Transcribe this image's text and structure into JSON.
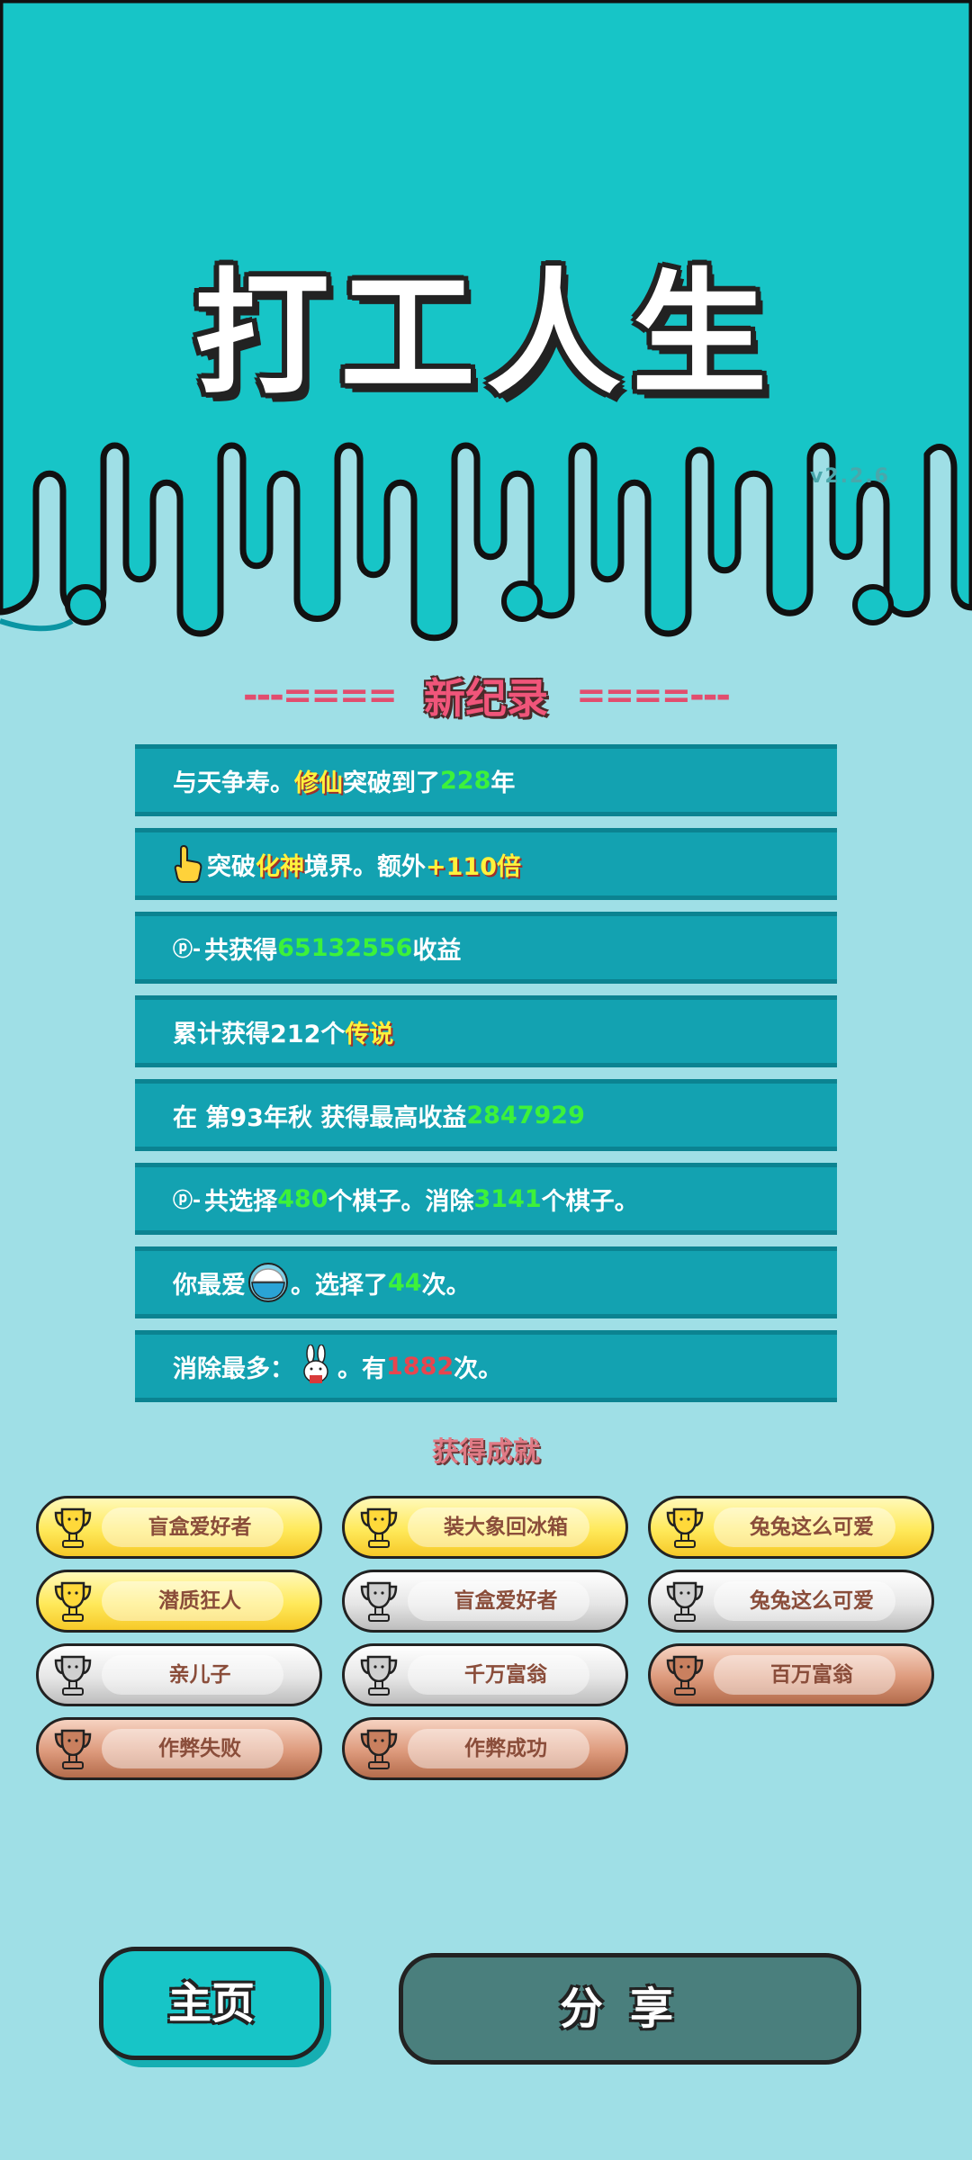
{
  "header": {
    "title": "打工人生",
    "version": "v2.2.6"
  },
  "records": {
    "title": "新纪录",
    "left_dashes": "---====",
    "right_dashes": "====---",
    "rows": [
      {
        "t1": "与天争寿。",
        "hl": "修仙",
        "t2": "突破到了",
        "num": "228",
        "t3": "年"
      },
      {
        "t1": "突破",
        "hl": "化神",
        "t2": "境界。额外",
        "num": "+110倍"
      },
      {
        "t1": "共获得",
        "num": "65132556",
        "t2": "收益"
      },
      {
        "t1": "累计获得212个",
        "hl": "传说"
      },
      {
        "t1": "在 第93年秋 获得最高收益",
        "num": "2847929"
      },
      {
        "t1": "共选择",
        "num": "480",
        "t2": "个棋子。消除",
        "num2": "3141",
        "t3": "个棋子。"
      },
      {
        "t1": "你最爱",
        "t2": "。选择了",
        "num": "44",
        "t3": "次。"
      },
      {
        "t1": "消除最多：",
        "t2": "。有",
        "num": "1882",
        "t3": "次。"
      }
    ],
    "icons": [
      "pointing-hand-icon",
      "swirl-icon",
      "rice-bowl-icon",
      "bunny-icon"
    ]
  },
  "achievements": {
    "title": "获得成就",
    "items": [
      {
        "label": "盲盒爱好者",
        "tier": "gold"
      },
      {
        "label": "装大象回冰箱",
        "tier": "gold"
      },
      {
        "label": "兔兔这么可爱",
        "tier": "gold"
      },
      {
        "label": "潜质狂人",
        "tier": "gold"
      },
      {
        "label": "盲盒爱好者",
        "tier": "silver"
      },
      {
        "label": "兔兔这么可爱",
        "tier": "silver"
      },
      {
        "label": "亲儿子",
        "tier": "silver"
      },
      {
        "label": "千万富翁",
        "tier": "silver"
      },
      {
        "label": "百万富翁",
        "tier": "bronze"
      },
      {
        "label": "作弊失败",
        "tier": "bronze"
      },
      {
        "label": "作弊成功",
        "tier": "bronze"
      }
    ]
  },
  "buttons": {
    "home": "主页",
    "share": "分享"
  },
  "colors": {
    "header_teal": "#17c5c7",
    "page_bg": "#9fdfe6",
    "row_bg": "#13a2b1",
    "highlight_green": "#3df23a",
    "highlight_yellow": "#fff23c",
    "highlight_red": "#e8454e",
    "title_pink": "#f0557a"
  }
}
